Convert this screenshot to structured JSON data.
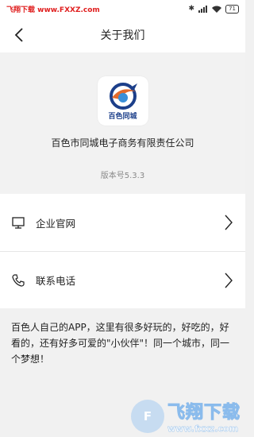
{
  "statusbar": {
    "watermark": "飞翔下载 www.FXXZ.com",
    "battery": "71"
  },
  "nav": {
    "title": "关于我们"
  },
  "app": {
    "logo_text": "百色同城",
    "company": "百色市同城电子商务有限责任公司",
    "version": "版本号5.3.3"
  },
  "menu": {
    "items": [
      {
        "label": "企业官网",
        "icon": "monitor-icon"
      },
      {
        "label": "联系电话",
        "icon": "phone-icon"
      }
    ]
  },
  "description": "百色人自己的APP，这里有很多好玩的，好吃的，好看的，还有好多可爱的\"小伙伴\"！同一个城市，同一个梦想！",
  "brand_watermark": {
    "main": "飞翔下载",
    "url": "www.fxxz.com"
  },
  "colors": {
    "logo_blue": "#1c3f8a",
    "watermark_red": "#e02020"
  }
}
